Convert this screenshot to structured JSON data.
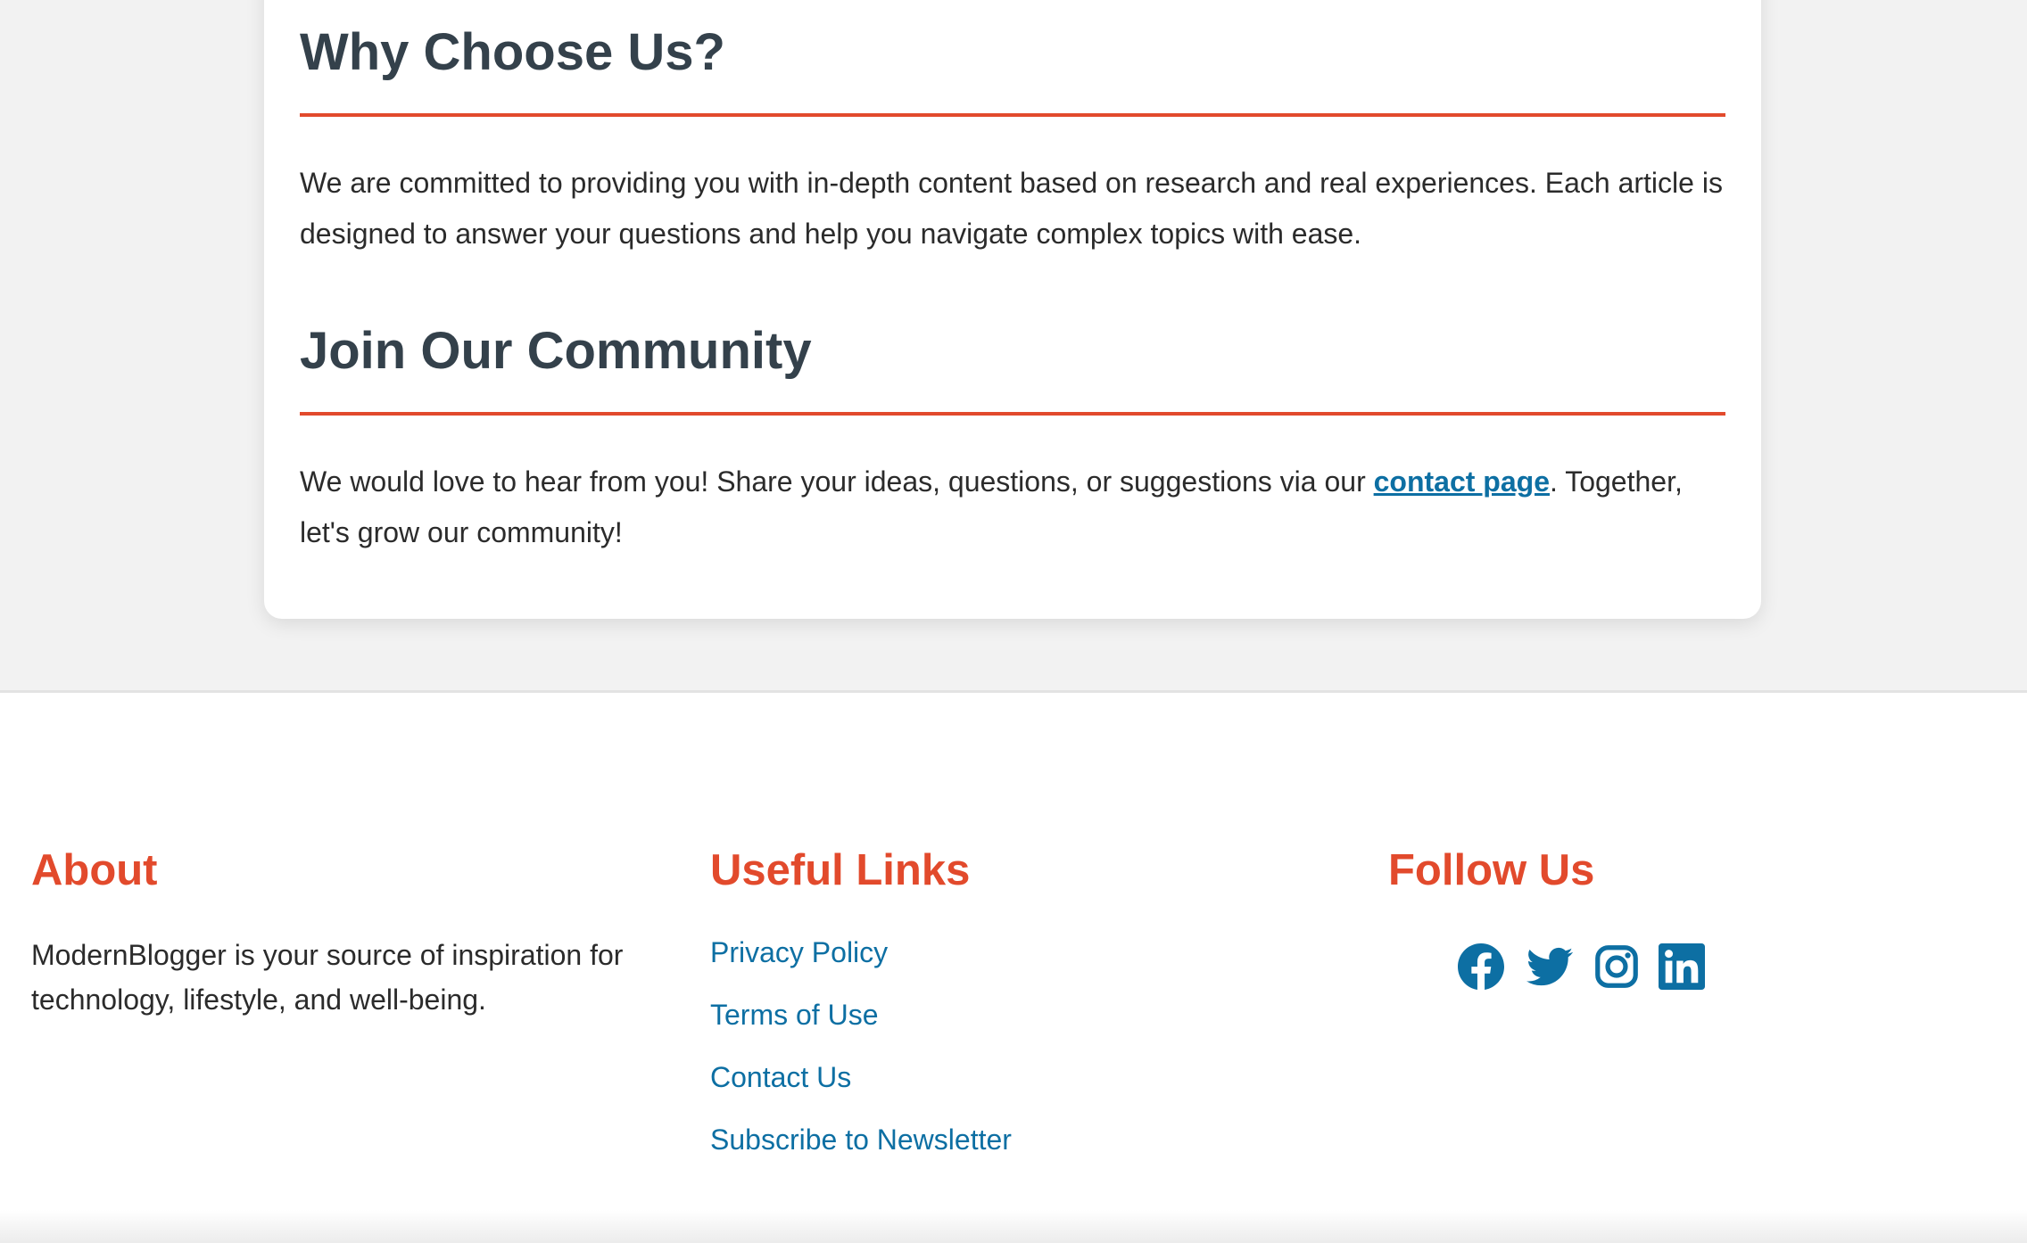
{
  "main": {
    "why": {
      "title": "Why Choose Us?",
      "text": "We are committed to providing you with in-depth content based on research and real experiences. Each article is designed to answer your questions and help you navigate complex topics with ease."
    },
    "community": {
      "title": "Join Our Community",
      "text_before": "We would love to hear from you! Share your ideas, questions, or suggestions via our ",
      "link_label": "contact page",
      "text_after": ". Together, let's grow our community!"
    }
  },
  "footer": {
    "about": {
      "title": "About",
      "text": "ModernBlogger is your source of inspiration for technology, lifestyle, and well-being."
    },
    "links": {
      "title": "Useful Links",
      "items": [
        "Privacy Policy",
        "Terms of Use",
        "Contact Us",
        "Subscribe to Newsletter"
      ]
    },
    "follow": {
      "title": "Follow Us",
      "icons": [
        "facebook-icon",
        "twitter-icon",
        "instagram-icon",
        "linkedin-icon"
      ]
    }
  },
  "colors": {
    "accent": "#e24a2c",
    "link": "#0d6fa3",
    "heading": "#34414b",
    "background": "#f2f2f2"
  }
}
